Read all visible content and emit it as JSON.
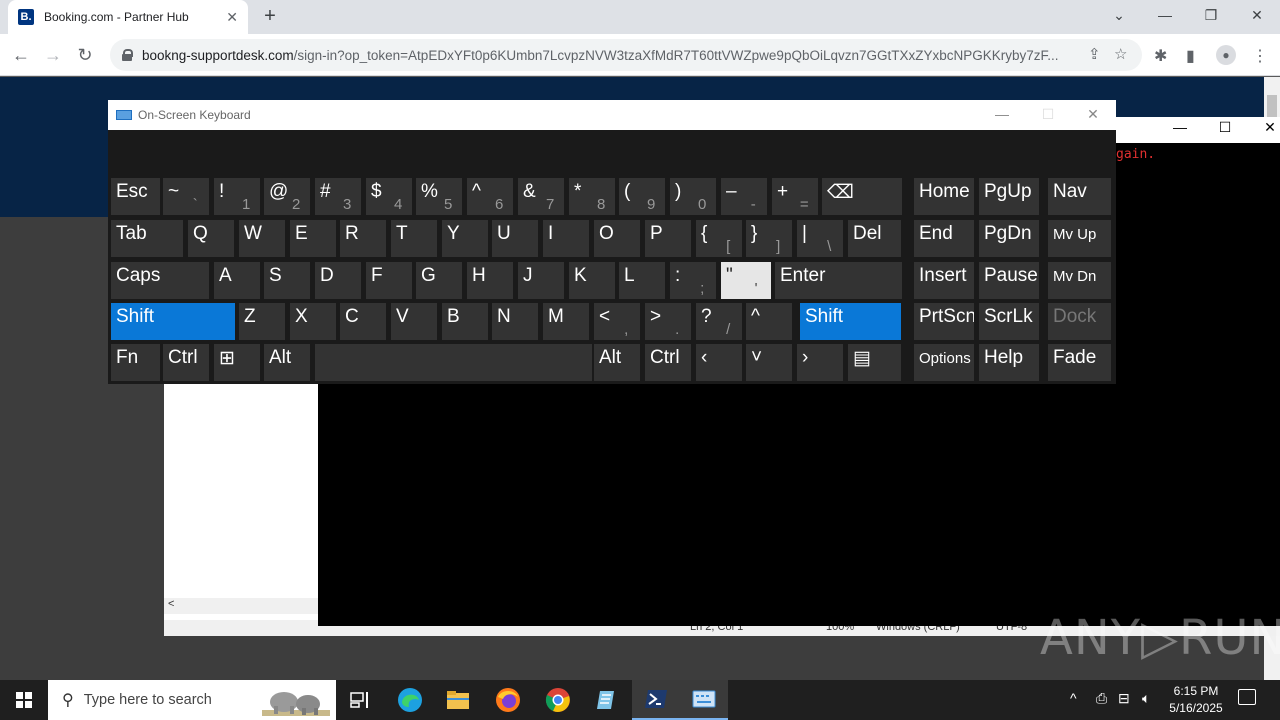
{
  "browser": {
    "tab_title": "Booking.com - Partner Hub",
    "favicon_letter": "B.",
    "url_host": "bookng-supportdesk.com",
    "url_path": "/sign-in?op_token=AtpEDxYFt0p6KUmbn7LcvpzNVW3tzaXfMdR7T60ttVWZpwe9pQbOiLqvzn7GGtTXxZYxbcNPGKKryby7zF..."
  },
  "console": {
    "text": "gain."
  },
  "notepad": {
    "hscroll_arrow": "<",
    "status_position": "Ln 2, Col 1",
    "status_zoom": "100%",
    "status_eol": "Windows (CRLF)",
    "status_encoding": "UTF-8"
  },
  "osk": {
    "title": "On-Screen Keyboard",
    "rows": [
      [
        {
          "label": "Esc"
        },
        {
          "label": "~",
          "sub": "`"
        },
        {
          "label": "!",
          "sub": "1"
        },
        {
          "label": "@",
          "sub": "2"
        },
        {
          "label": "#",
          "sub": "3"
        },
        {
          "label": "$",
          "sub": "4"
        },
        {
          "label": "%",
          "sub": "5"
        },
        {
          "label": "^",
          "sub": "6"
        },
        {
          "label": "&",
          "sub": "7"
        },
        {
          "label": "*",
          "sub": "8"
        },
        {
          "label": "(",
          "sub": "9"
        },
        {
          "label": ")",
          "sub": "0"
        },
        {
          "label": "–",
          "sub": "-"
        },
        {
          "label": "+",
          "sub": "="
        },
        {
          "label": "⌫"
        },
        {
          "label": "Home"
        },
        {
          "label": "PgUp"
        },
        {
          "label": "Nav"
        }
      ],
      [
        {
          "label": "Tab"
        },
        {
          "label": "Q"
        },
        {
          "label": "W"
        },
        {
          "label": "E"
        },
        {
          "label": "R"
        },
        {
          "label": "T"
        },
        {
          "label": "Y"
        },
        {
          "label": "U"
        },
        {
          "label": "I"
        },
        {
          "label": "O"
        },
        {
          "label": "P"
        },
        {
          "label": "{",
          "sub": "["
        },
        {
          "label": "}",
          "sub": "]"
        },
        {
          "label": "|",
          "sub": "\\"
        },
        {
          "label": "Del"
        },
        {
          "label": "End"
        },
        {
          "label": "PgDn"
        },
        {
          "label": "Mv Up"
        }
      ],
      [
        {
          "label": "Caps"
        },
        {
          "label": "A"
        },
        {
          "label": "S"
        },
        {
          "label": "D"
        },
        {
          "label": "F"
        },
        {
          "label": "G"
        },
        {
          "label": "H"
        },
        {
          "label": "J"
        },
        {
          "label": "K"
        },
        {
          "label": "L"
        },
        {
          "label": ":",
          "sub": ";"
        },
        {
          "label": "\"",
          "sub": "'"
        },
        {
          "label": "Enter"
        },
        {
          "label": "Insert"
        },
        {
          "label": "Pause"
        },
        {
          "label": "Mv Dn"
        }
      ],
      [
        {
          "label": "Shift"
        },
        {
          "label": "Z"
        },
        {
          "label": "X"
        },
        {
          "label": "C"
        },
        {
          "label": "V"
        },
        {
          "label": "B"
        },
        {
          "label": "N"
        },
        {
          "label": "M"
        },
        {
          "label": "<",
          "sub": ","
        },
        {
          "label": ">",
          "sub": "."
        },
        {
          "label": "?",
          "sub": "/"
        },
        {
          "label": "^"
        },
        {
          "label": "Shift"
        },
        {
          "label": "PrtScn"
        },
        {
          "label": "ScrLk"
        },
        {
          "label": "Dock"
        }
      ],
      [
        {
          "label": "Fn"
        },
        {
          "label": "Ctrl"
        },
        {
          "label": "⊞"
        },
        {
          "label": "Alt"
        },
        {
          "label": ""
        },
        {
          "label": "Alt"
        },
        {
          "label": "Ctrl"
        },
        {
          "label": "‹"
        },
        {
          "label": "˅"
        },
        {
          "label": "›"
        },
        {
          "label": "▤"
        },
        {
          "label": "Options"
        },
        {
          "label": "Help"
        },
        {
          "label": "Fade"
        }
      ]
    ]
  },
  "watermark": "ANY▷RUN",
  "taskbar": {
    "search_placeholder": "Type here to search",
    "time": "6:15 PM",
    "date": "5/16/2025"
  }
}
